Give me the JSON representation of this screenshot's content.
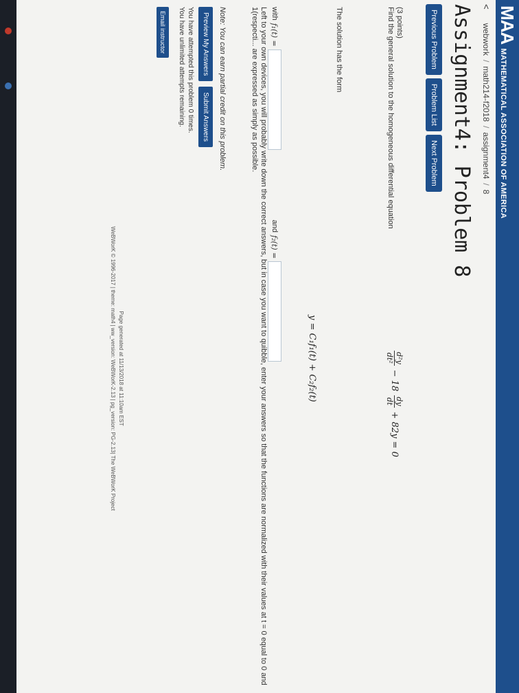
{
  "header": {
    "logo_mark": "MAA",
    "logo_text": "MATHEMATICAL ASSOCIATION OF AMERICA"
  },
  "breadcrumb": {
    "back": "<",
    "items": [
      "webwork",
      "math214-f2018",
      "assignment4",
      "8"
    ],
    "separator": "/"
  },
  "title": "Assignment4: Problem 8",
  "nav": {
    "previous": "Previous Problem",
    "list": "Problem List",
    "next": "Next Problem"
  },
  "problem": {
    "points": "(3 points)",
    "prompt": "Find the general solution to the homogeneous differential equation",
    "eq_d2y": "d²y",
    "eq_dt2": "dt²",
    "eq_minus_coef": "− 18",
    "eq_dy": "dy",
    "eq_dt": "dt",
    "eq_tail": "+ 82y = 0",
    "solution_form_text": "The solution has the form",
    "solution_form": "y = C₁f₁(t) + C₂f₂(t)",
    "with_label": "with",
    "f1_label": "f₁(t) =",
    "and_label": "and",
    "f2_label": "f₂(t) =",
    "f1_value": "",
    "f2_value": "",
    "hint": "Left to your own devices, you will probably write down the correct answers, but in case you want to quibble, enter your answers so that the functions are normalized with their values at t = 0 equal to 0 and 1(respecti... are expressed as simply as possible."
  },
  "note": "Note: You can earn partial credit on this problem.",
  "actions": {
    "preview": "Preview My Answers",
    "submit": "Submit Answers"
  },
  "attempts": {
    "line1": "You have attempted this problem 0 times.",
    "line2": "You have unlimited attempts remaining."
  },
  "email_instructor": "Email instructor",
  "footer": {
    "line1": "Page generated at 11/13/2018 at 11:10am EST",
    "line2": "WeBWorK © 1996-2017 | theme: math4 | ww_version: WeBWorK-2.13 | pg_version: PG-2.13| The WeBWorK Project"
  }
}
